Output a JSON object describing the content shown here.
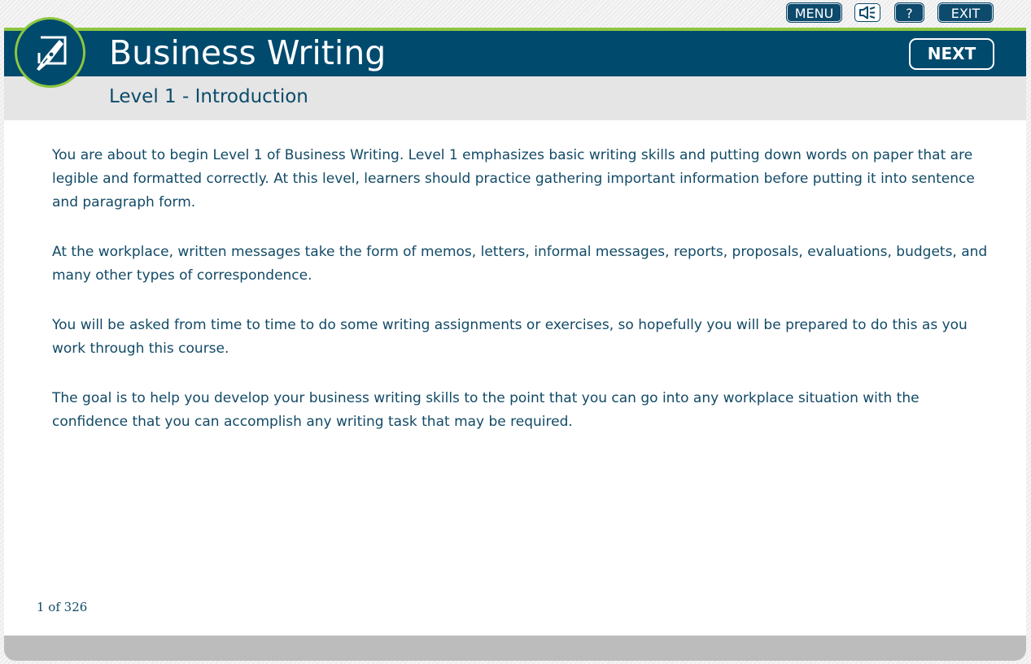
{
  "toolbar": {
    "menu_label": "MENU",
    "audio_icon": "speaker-icon",
    "help_label": "?",
    "exit_label": "EXIT"
  },
  "header": {
    "title": "Business Writing",
    "next_label": "NEXT",
    "logo_icon": "pen-nib-icon"
  },
  "subheader": {
    "title": "Level 1 - Introduction"
  },
  "content": {
    "paragraphs": [
      "You are about to begin Level 1 of Business Writing. Level 1 emphasizes basic writing skills and putting down words on paper that are legible and formatted correctly. At this level, learners should practice gathering important information before putting it into sentence and paragraph form.",
      "At the workplace, written messages take the form of memos, letters, informal messages, reports, proposals, evaluations, budgets, and many other types of correspondence.",
      "You will be asked from time to time to do some writing assignments or exercises, so hopefully you will be prepared to do this as you work through this course.",
      "The goal is to help you develop your business writing skills to the point that you can go into any workplace situation with the confidence that you can accomplish any writing task that may be required."
    ]
  },
  "footer": {
    "page_counter": "1 of 326"
  },
  "colors": {
    "brand_blue": "#004a6e",
    "accent_green": "#8cc63f",
    "text_blue": "#124a66",
    "subheader_gray": "#e5e5e5",
    "footer_gray": "#bcbcbc"
  }
}
